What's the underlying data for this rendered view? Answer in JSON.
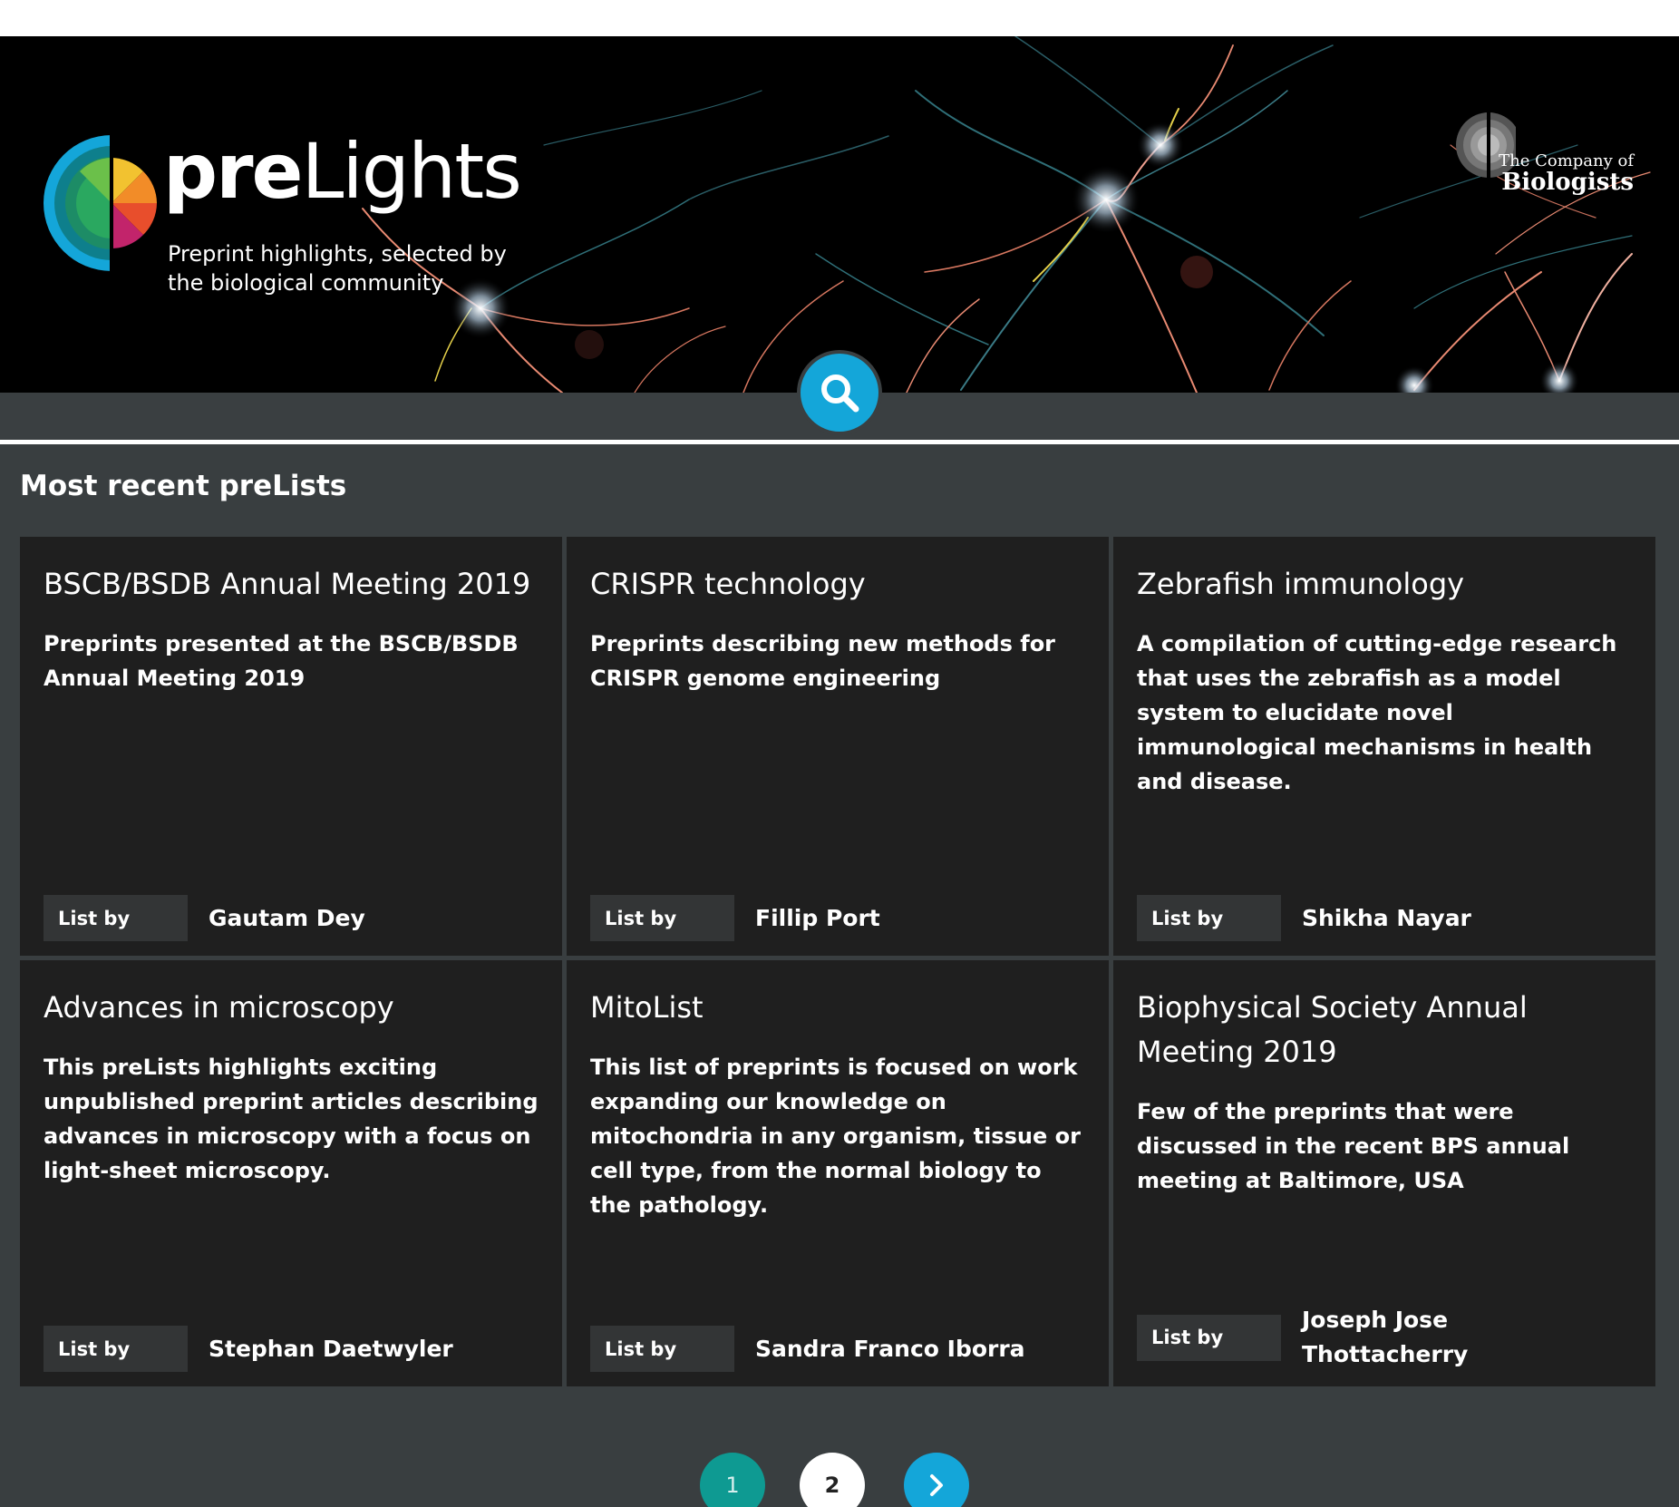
{
  "header": {
    "logo_pre": "pre",
    "logo_lights": "Lights",
    "tagline": "Preprint highlights, selected by the biological community",
    "publisher_small": "The Company of",
    "publisher_big": "Biologists"
  },
  "search": {
    "icon": "search-icon"
  },
  "section": {
    "title": "Most recent preLists"
  },
  "cards": [
    {
      "title": "BSCB/BSDB Annual Meeting 2019",
      "description": "Preprints presented at the BSCB/BSDB Annual Meeting 2019",
      "list_by_label": "List by",
      "author": "Gautam Dey"
    },
    {
      "title": "CRISPR technology",
      "description": "Preprints describing new methods for CRISPR genome engineering",
      "list_by_label": "List by",
      "author": "Fillip Port"
    },
    {
      "title": "Zebrafish immunology",
      "description": "A compilation of cutting-edge research that uses the zebrafish as a model system to elucidate novel immunological mechanisms in health and disease.",
      "list_by_label": "List by",
      "author": "Shikha Nayar"
    },
    {
      "title": "Advances in microscopy",
      "description": "This preLists highlights exciting unpublished preprint articles describing advances in microscopy with a focus on light-sheet microscopy.",
      "list_by_label": "List by",
      "author": "Stephan Daetwyler"
    },
    {
      "title": "MitoList",
      "description": "This list of preprints is focused on work expanding our knowledge on mitochondria in any organism, tissue or cell type, from the normal biology to the pathology.",
      "list_by_label": "List by",
      "author": "Sandra Franco Iborra"
    },
    {
      "title": "Biophysical Society Annual Meeting 2019",
      "description": "Few of the preprints that were discussed in the recent BPS annual meeting at Baltimore, USA",
      "list_by_label": "List by",
      "author": "Joseph Jose Thottacherry"
    }
  ],
  "pagination": {
    "page_1": "1",
    "page_2": "2",
    "current_page": 2,
    "next_icon": "chevron-right-icon"
  },
  "colors": {
    "accent_blue": "#14a6d9",
    "accent_teal": "#0e9a92",
    "panel_bg": "#393e40",
    "card_bg": "#1f1f1f"
  }
}
